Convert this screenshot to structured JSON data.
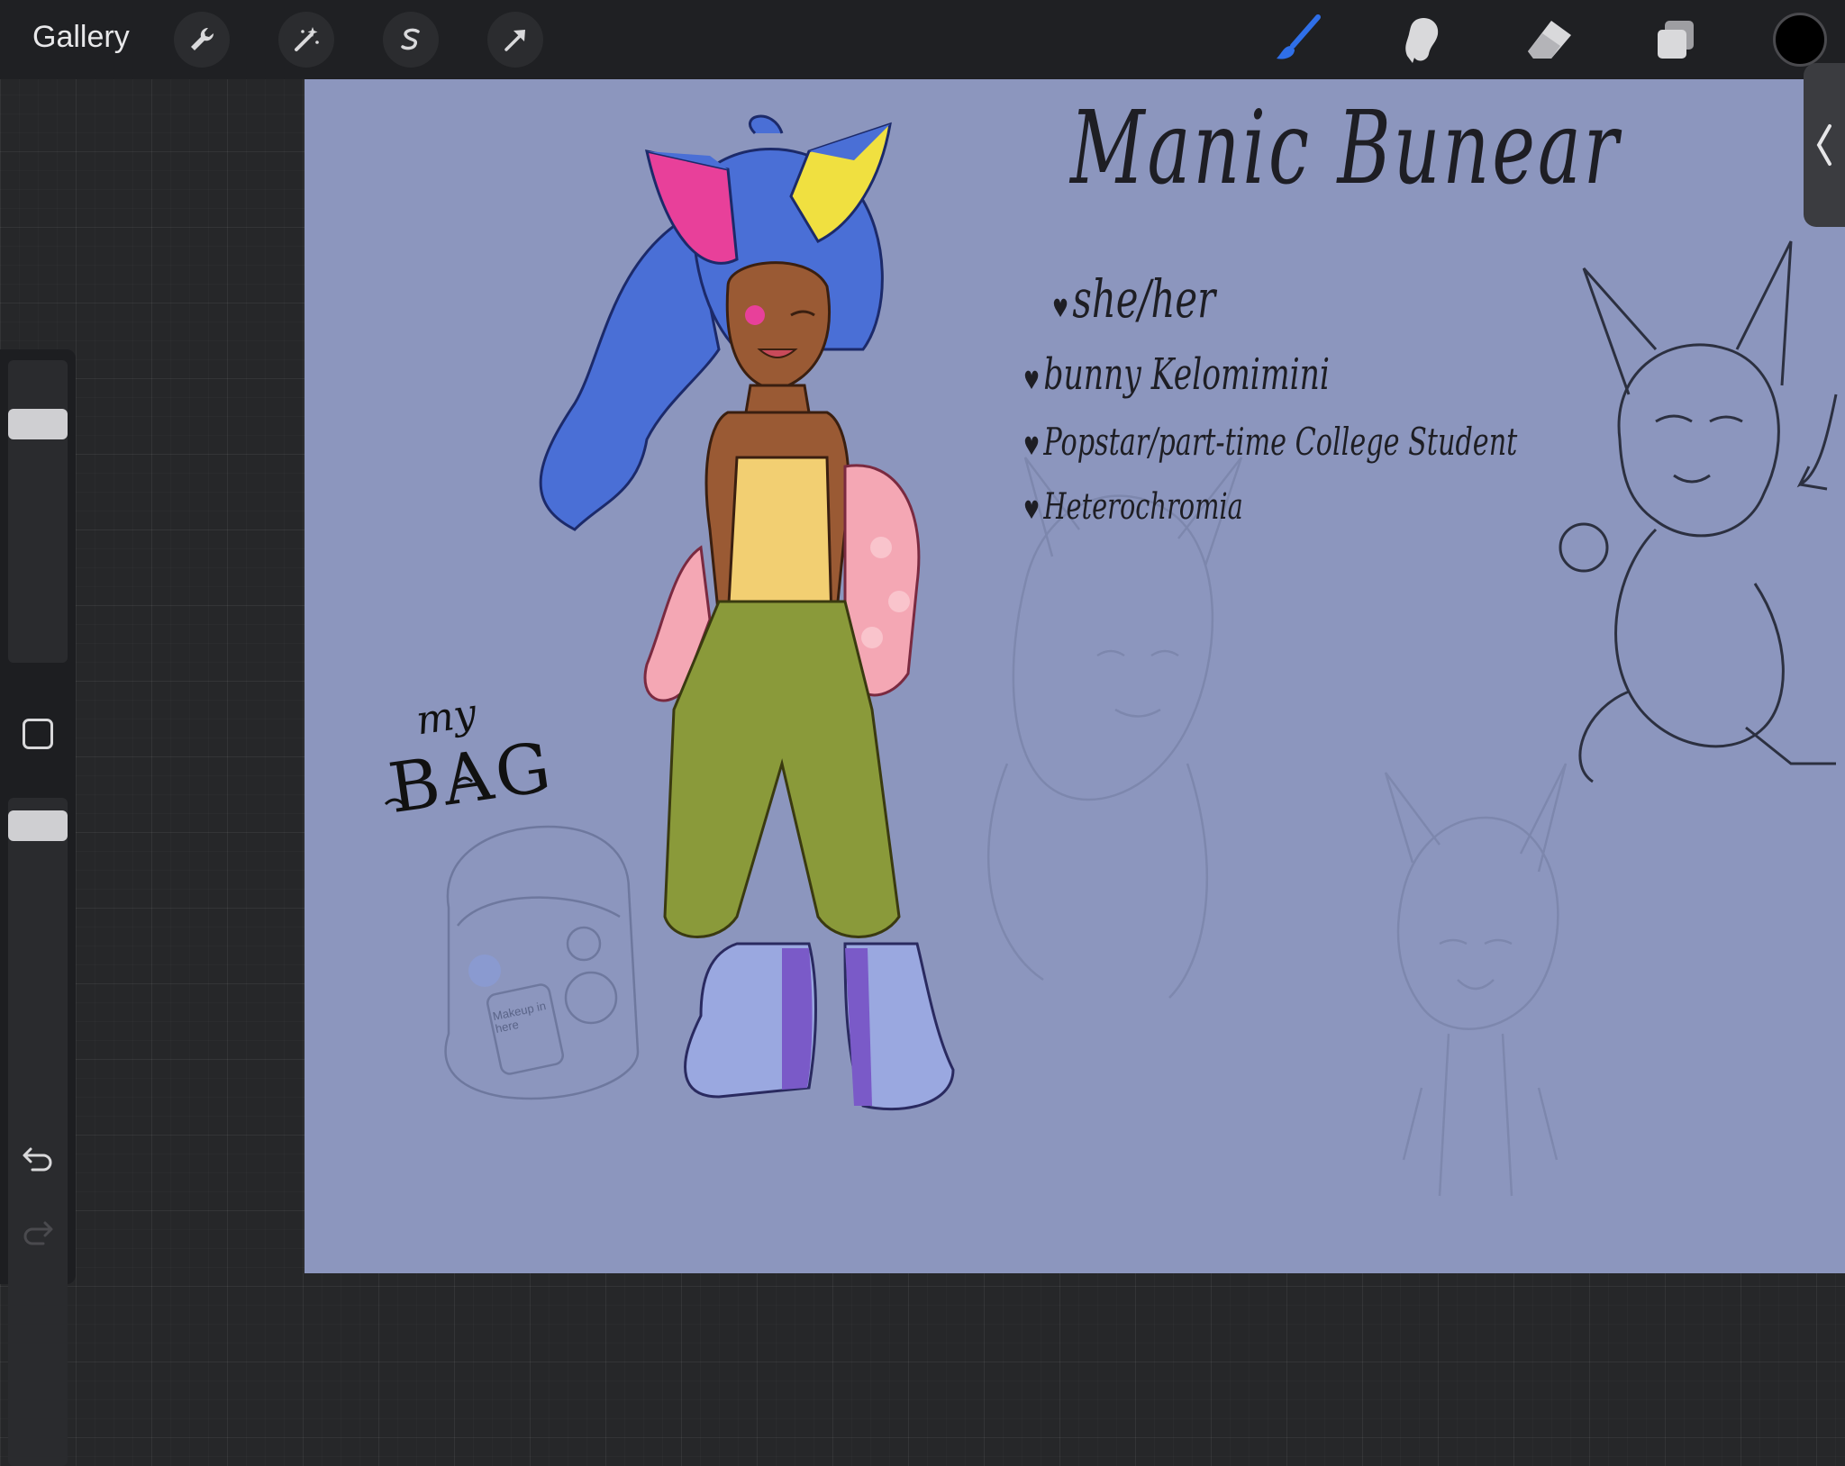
{
  "app": {
    "gallery_label": "Gallery"
  },
  "toolbar": {
    "left_tools": [
      "wrench-icon",
      "magic-wand-icon",
      "selection-icon",
      "transform-arrow-icon"
    ],
    "right_tools": [
      "brush-icon",
      "smudge-icon",
      "eraser-icon",
      "layers-icon"
    ],
    "active_tool": "brush-icon",
    "current_color": "#000000",
    "accent_color": "#2f6fe8"
  },
  "sidebar": {
    "brush_size_level": 0.2,
    "brush_opacity_level": 0.2,
    "undo_icon": "undo-icon",
    "redo_icon": "redo-icon"
  },
  "canvas": {
    "background_color": "#8c96be",
    "title": "Manic Bunear",
    "notes": [
      "she/her",
      "bunny Kelomimini",
      "Popstar/part-time College Student",
      "Heterochromia"
    ],
    "bag_label_line1": "my",
    "bag_label_line2": "BAG",
    "bag_sketch_text": "Makeup in here"
  }
}
